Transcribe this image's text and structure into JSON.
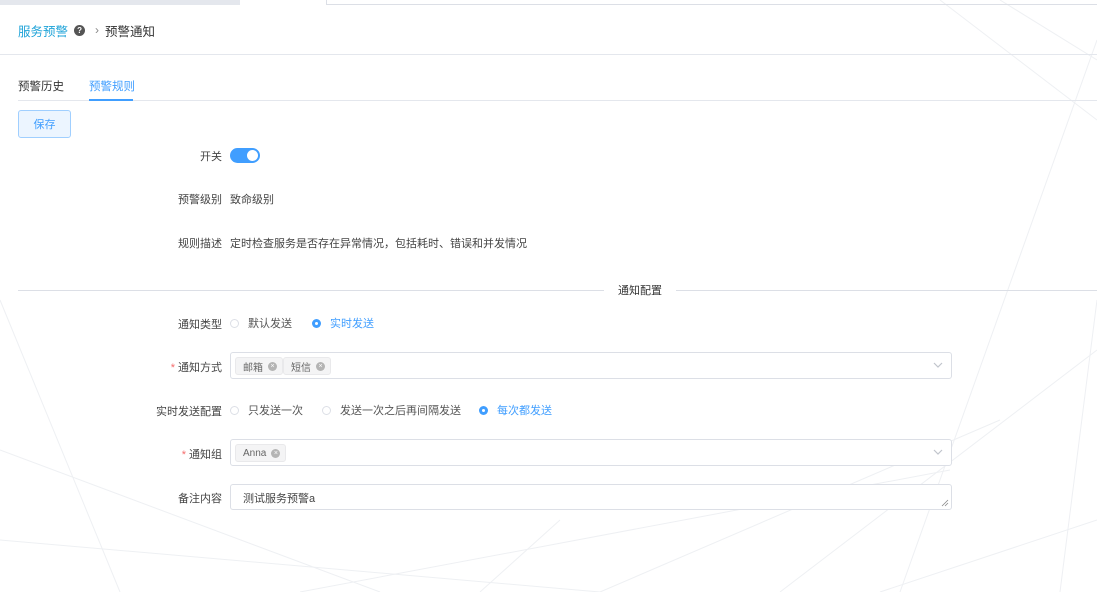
{
  "breadcrumb": {
    "parent": "服务预警",
    "current": "预警通知"
  },
  "tabs": [
    {
      "label": "预警历史"
    },
    {
      "label": "预警规则"
    }
  ],
  "toolbar": {
    "save_label": "保存"
  },
  "form": {
    "switch": {
      "label": "开关",
      "on": true
    },
    "level": {
      "label": "预警级别",
      "value": "致命级别"
    },
    "description": {
      "label": "规则描述",
      "value": "定时检查服务是否存在异常情况，包括耗时、错误和并发情况"
    }
  },
  "notify_section": {
    "title": "通知配置",
    "type": {
      "label": "通知类型",
      "options": [
        "默认发送",
        "实时发送"
      ],
      "selected": "实时发送"
    },
    "method": {
      "label": "通知方式",
      "required": "*",
      "tags": [
        "邮箱",
        "短信"
      ]
    },
    "realtime": {
      "label": "实时发送配置",
      "options": [
        "只发送一次",
        "发送一次之后再间隔发送",
        "每次都发送"
      ],
      "selected": "每次都发送"
    },
    "group": {
      "label": "通知组",
      "required": "*",
      "tags": [
        "Anna"
      ]
    },
    "remark": {
      "label": "备注内容",
      "value": "测试服务预警a"
    }
  },
  "colors": {
    "accent": "#409eff",
    "link": "#1fa3d8",
    "required": "#f56c6c"
  }
}
